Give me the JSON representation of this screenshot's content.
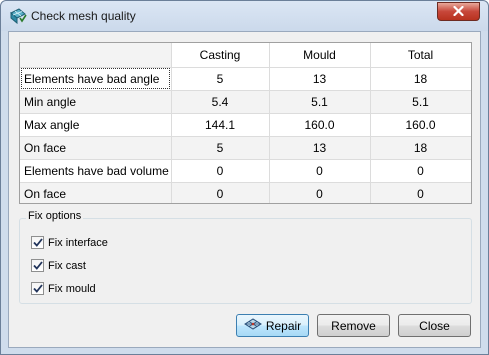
{
  "window": {
    "title": "Check mesh quality"
  },
  "table": {
    "headers": [
      "",
      "Casting",
      "Mould",
      "Total"
    ],
    "rows": [
      {
        "label": "Elements have bad angle",
        "casting": "5",
        "mould": "13",
        "total": "18"
      },
      {
        "label": "Min angle",
        "casting": "5.4",
        "mould": "5.1",
        "total": "5.1"
      },
      {
        "label": "Max angle",
        "casting": "144.1",
        "mould": "160.0",
        "total": "160.0"
      },
      {
        "label": "On face",
        "casting": "5",
        "mould": "13",
        "total": "18"
      },
      {
        "label": "Elements have bad volume",
        "casting": "0",
        "mould": "0",
        "total": "0"
      },
      {
        "label": "On face",
        "casting": "0",
        "mould": "0",
        "total": "0"
      }
    ]
  },
  "fix_options": {
    "title": "Fix options",
    "items": [
      {
        "label": "Fix interface",
        "checked": true
      },
      {
        "label": "Fix cast",
        "checked": true
      },
      {
        "label": "Fix mould",
        "checked": true
      }
    ]
  },
  "buttons": {
    "repair": "Repair",
    "remove": "Remove",
    "close": "Close"
  },
  "icons": {
    "app": "mesh-quality-icon",
    "repair": "repair-mesh-icon",
    "close": "close-icon",
    "check": "checkmark-icon"
  }
}
